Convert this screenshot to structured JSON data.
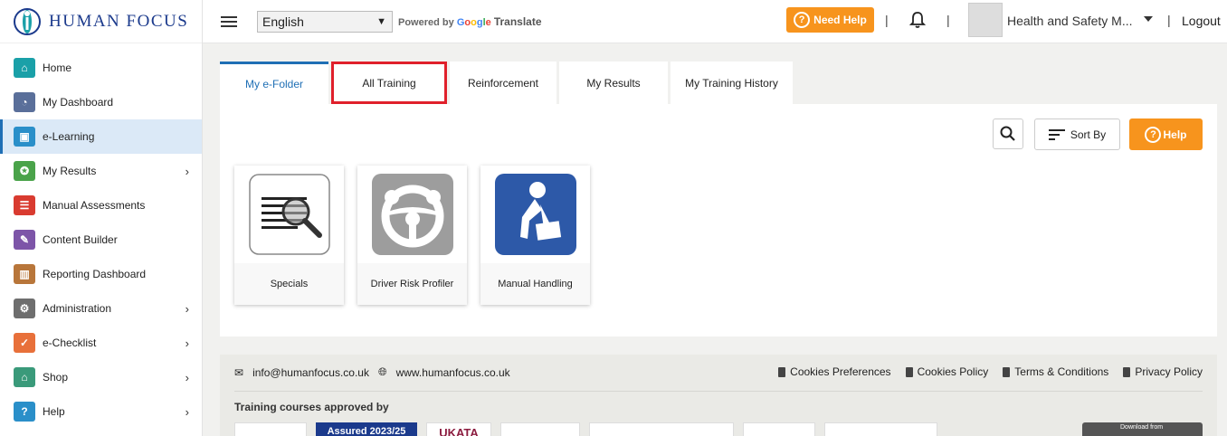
{
  "brand": {
    "name": "HUMAN FOCUS"
  },
  "sidebar": {
    "items": [
      {
        "label": "Home",
        "color": "#1aa0a8"
      },
      {
        "label": "My Dashboard",
        "color": "#5a6f9a"
      },
      {
        "label": "e-Learning",
        "color": "#2a8fc9"
      },
      {
        "label": "My Results",
        "color": "#4aa34a"
      },
      {
        "label": "Manual Assessments",
        "color": "#d93b30"
      },
      {
        "label": "Content Builder",
        "color": "#7d55a8"
      },
      {
        "label": "Reporting Dashboard",
        "color": "#b8763a"
      },
      {
        "label": "Administration",
        "color": "#6e6e6e"
      },
      {
        "label": "e-Checklist",
        "color": "#e8703a"
      },
      {
        "label": "Shop",
        "color": "#3a9a7a"
      },
      {
        "label": "Help",
        "color": "#2a8fc9"
      }
    ],
    "active_index": 2
  },
  "topbar": {
    "language": "English",
    "powered_by": "Powered by",
    "google": [
      "G",
      "o",
      "o",
      "g",
      "l",
      "e"
    ],
    "translate": "Translate",
    "need_help": "Need Help",
    "user_name": "Health and Safety M...",
    "logout": "Logout"
  },
  "tabs": [
    {
      "label": "My e-Folder"
    },
    {
      "label": "All Training"
    },
    {
      "label": "Reinforcement"
    },
    {
      "label": "My Results"
    },
    {
      "label": "My Training History"
    }
  ],
  "toolbar": {
    "sort_label": "Sort By",
    "help_label": "Help"
  },
  "courses": [
    {
      "title": "Specials"
    },
    {
      "title": "Driver Risk Profiler"
    },
    {
      "title": "Manual Handling"
    }
  ],
  "footer": {
    "email": "info@humanfocus.co.uk",
    "website": "www.humanfocus.co.uk",
    "links": [
      "Cookies Preferences",
      "Cookies Policy",
      "Terms & Conditions",
      "Privacy Policy"
    ],
    "approved_by": "Training courses approved by",
    "logos": [
      "",
      "Assured 2023/25",
      "UKATA",
      "",
      "",
      "",
      ""
    ],
    "appstore": "Download from"
  },
  "colors": {
    "accent": "#1f6fb5",
    "orange": "#f7941d",
    "highlight": "#e0202b"
  }
}
